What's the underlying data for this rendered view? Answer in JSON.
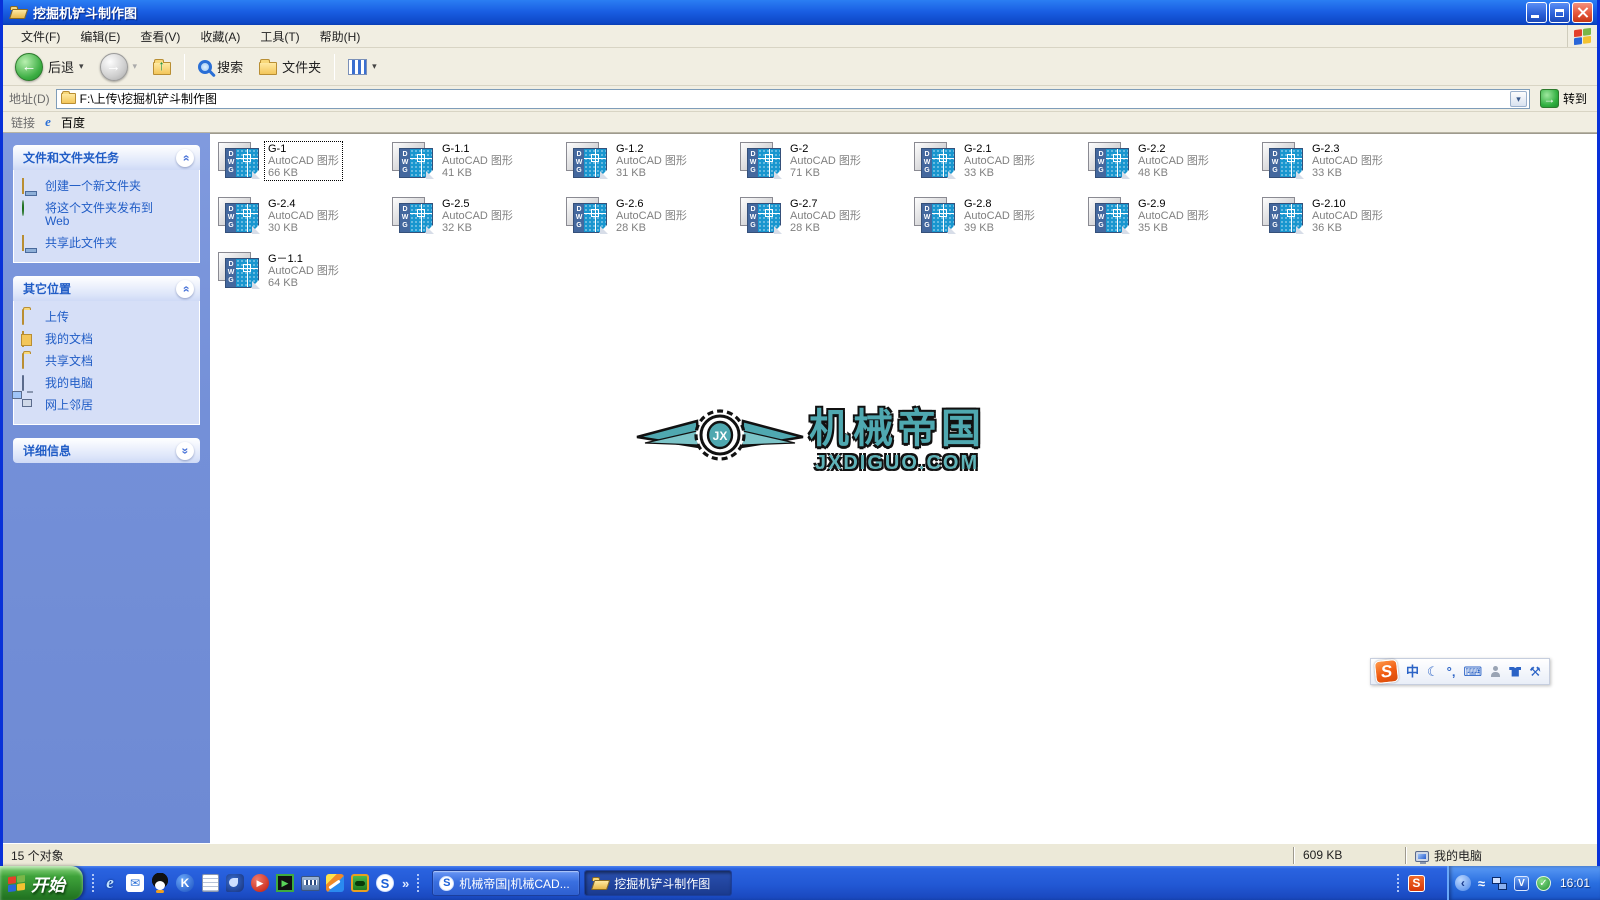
{
  "window": {
    "title": "挖掘机铲斗制作图"
  },
  "menu": {
    "items": [
      "文件(F)",
      "编辑(E)",
      "查看(V)",
      "收藏(A)",
      "工具(T)",
      "帮助(H)"
    ]
  },
  "toolbar": {
    "back_label": "后退",
    "search_label": "搜索",
    "folders_label": "文件夹"
  },
  "address": {
    "label": "地址(D)",
    "value": "F:\\上传\\挖掘机铲斗制作图",
    "go_label": "转到"
  },
  "links": {
    "label": "链接",
    "baidu_label": "百度"
  },
  "sidebar": {
    "tasks_panel": {
      "title": "文件和文件夹任务",
      "items": [
        "创建一个新文件夹",
        "将这个文件夹发布到 Web",
        "共享此文件夹"
      ]
    },
    "places_panel": {
      "title": "其它位置",
      "items": [
        "上传",
        "我的文档",
        "共享文档",
        "我的电脑",
        "网上邻居"
      ]
    },
    "details_panel": {
      "title": "详细信息"
    }
  },
  "files": {
    "type_label": "AutoCAD 图形",
    "items": [
      {
        "name": "G-1",
        "size": "66 KB"
      },
      {
        "name": "G-1.1",
        "size": "41 KB"
      },
      {
        "name": "G-1.2",
        "size": "31 KB"
      },
      {
        "name": "G-2",
        "size": "71 KB"
      },
      {
        "name": "G-2.1",
        "size": "33 KB"
      },
      {
        "name": "G-2.2",
        "size": "48 KB"
      },
      {
        "name": "G-2.3",
        "size": "33 KB"
      },
      {
        "name": "G-2.4",
        "size": "30 KB"
      },
      {
        "name": "G-2.5",
        "size": "32 KB"
      },
      {
        "name": "G-2.6",
        "size": "28 KB"
      },
      {
        "name": "G-2.7",
        "size": "28 KB"
      },
      {
        "name": "G-2.8",
        "size": "39 KB"
      },
      {
        "name": "G-2.9",
        "size": "35 KB"
      },
      {
        "name": "G-2.10",
        "size": "36 KB"
      },
      {
        "name": "G－1.1",
        "size": "64 KB"
      }
    ]
  },
  "watermark": {
    "monogram": "JX",
    "title": "机械帝国",
    "url": "JXDIGUO.COM",
    "accent_color": "#4FA8B0"
  },
  "ime": {
    "mode": "中"
  },
  "status": {
    "objects_label": "15 个对象",
    "size_label": "609 KB",
    "zone_label": "我的电脑"
  },
  "taskbar": {
    "start_label": "开始",
    "tasks": [
      {
        "label": "机械帝国|机械CAD..."
      },
      {
        "label": "挖掘机铲斗制作图"
      }
    ],
    "clock": "16:01"
  },
  "icons": {
    "dropdown_glyph": "▾",
    "back_arrow": "←",
    "forward_arrow": "→",
    "up_arrow": "↑",
    "go_arrow": "→",
    "chevron_double": "»",
    "overflow_glyph": "»",
    "ie_glyph": "e",
    "mail_glyph": "✉",
    "k_glyph": "K",
    "s_glyph": "S",
    "play_glyph": "▶",
    "check_glyph": "✓",
    "v_glyph": "V",
    "moon_glyph": "☾",
    "keyboard_glyph": "⌨",
    "punct_glyph": "°‚",
    "wrench_glyph": "⚒",
    "swoosh_glyph": "≈",
    "tray_collapse_glyph": "‹",
    "dwg_letters": "DWG"
  }
}
